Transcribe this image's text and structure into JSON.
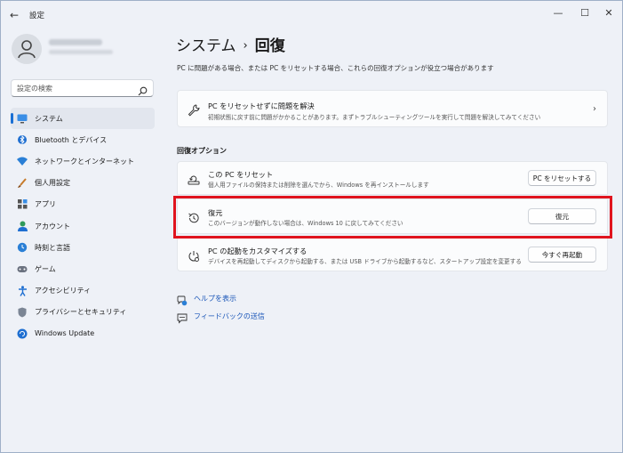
{
  "window": {
    "title": "設定"
  },
  "sidebar": {
    "search_placeholder": "設定の検索",
    "items": [
      {
        "label": "システム",
        "icon": "monitor-icon",
        "active": true
      },
      {
        "label": "Bluetooth とデバイス",
        "icon": "bluetooth-icon"
      },
      {
        "label": "ネットワークとインターネット",
        "icon": "wifi-icon"
      },
      {
        "label": "個人用設定",
        "icon": "brush-icon"
      },
      {
        "label": "アプリ",
        "icon": "apps-icon"
      },
      {
        "label": "アカウント",
        "icon": "account-icon"
      },
      {
        "label": "時刻と言語",
        "icon": "globe-clock-icon"
      },
      {
        "label": "ゲーム",
        "icon": "gamepad-icon"
      },
      {
        "label": "アクセシビリティ",
        "icon": "accessibility-icon"
      },
      {
        "label": "プライバシーとセキュリティ",
        "icon": "shield-icon"
      },
      {
        "label": "Windows Update",
        "icon": "windows-update-icon"
      }
    ]
  },
  "main": {
    "breadcrumb": {
      "parent": "システム",
      "separator": "›",
      "current": "回復"
    },
    "description": "PC に問題がある場合、または PC をリセットする場合、これらの回復オプションが役立つ場合があります",
    "troubleshoot": {
      "title": "PC をリセットせずに問題を解決",
      "subtitle": "初期状態に戻す前に問題がかかることがあります。まずトラブルシューティングツールを実行して問題を解決してみてください"
    },
    "section_title": "回復オプション",
    "options": [
      {
        "title": "この PC をリセット",
        "subtitle": "個人用ファイルの保持または削除を選んでから、Windows を再インストールします",
        "button": "PC をリセットする"
      },
      {
        "title": "復元",
        "subtitle": "このバージョンが動作しない場合は、Windows 10 に戻してみてください",
        "button": "復元"
      },
      {
        "title": "PC の起動をカスタマイズする",
        "subtitle": "デバイスを再起動してディスクから起動する、または USB ドライブから起動するなど、スタートアップ設定を変更する",
        "button": "今すぐ再起動"
      }
    ],
    "links": [
      {
        "label": "ヘルプを表示"
      },
      {
        "label": "フィードバックの送信"
      }
    ]
  },
  "colors": {
    "accent": "#1a6fd4",
    "highlight": "#e0141e",
    "background": "#eef1f7"
  }
}
